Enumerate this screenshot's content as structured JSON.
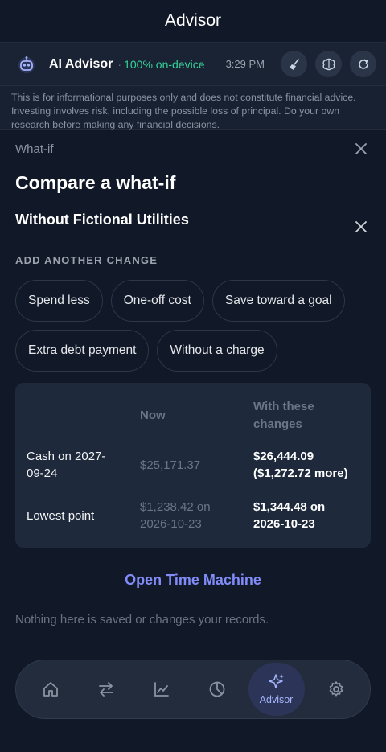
{
  "header": {
    "title": "Advisor"
  },
  "advisor_bar": {
    "name": "AI Advisor",
    "separator": "·",
    "status": "100% on-device",
    "time": "3:29 PM",
    "icons": [
      "robot-icon",
      "broom-icon",
      "brain-icon",
      "refresh-icon"
    ]
  },
  "disclaimer": "This is for informational purposes only and does not constitute financial advice. Investing involves risk, including the possible loss of principal. Do your own research before making any financial decisions.",
  "sheet": {
    "label": "What-if",
    "title": "Compare a what-if",
    "current_change": "Without Fictional Utilities",
    "add_label": "ADD ANOTHER CHANGE",
    "chips": [
      "Spend less",
      "One-off cost",
      "Save toward a goal",
      "Extra debt payment",
      "Without a charge"
    ],
    "table": {
      "col_now": "Now",
      "col_new": "With these changes",
      "rows": [
        {
          "label": "Cash on 2027-09-24",
          "now": "$25,171.37",
          "new": "$26,444.09 ($1,272.72 more)"
        },
        {
          "label": "Lowest point",
          "now": "$1,238.42 on 2026-10-23",
          "new": "$1,344.48 on 2026-10-23"
        }
      ]
    },
    "open_link": "Open Time Machine",
    "footnote": "Nothing here is saved or changes your records."
  },
  "tabbar": {
    "tabs": [
      "home-icon",
      "transfers-icon",
      "trends-icon",
      "budget-pie-icon",
      "advisor-sparkle-icon",
      "settings-gear-icon"
    ],
    "active_label": "Advisor"
  },
  "colors": {
    "accent": "#818cf8",
    "status_green": "#34d399",
    "background": "#111827",
    "card": "#1e293b"
  }
}
